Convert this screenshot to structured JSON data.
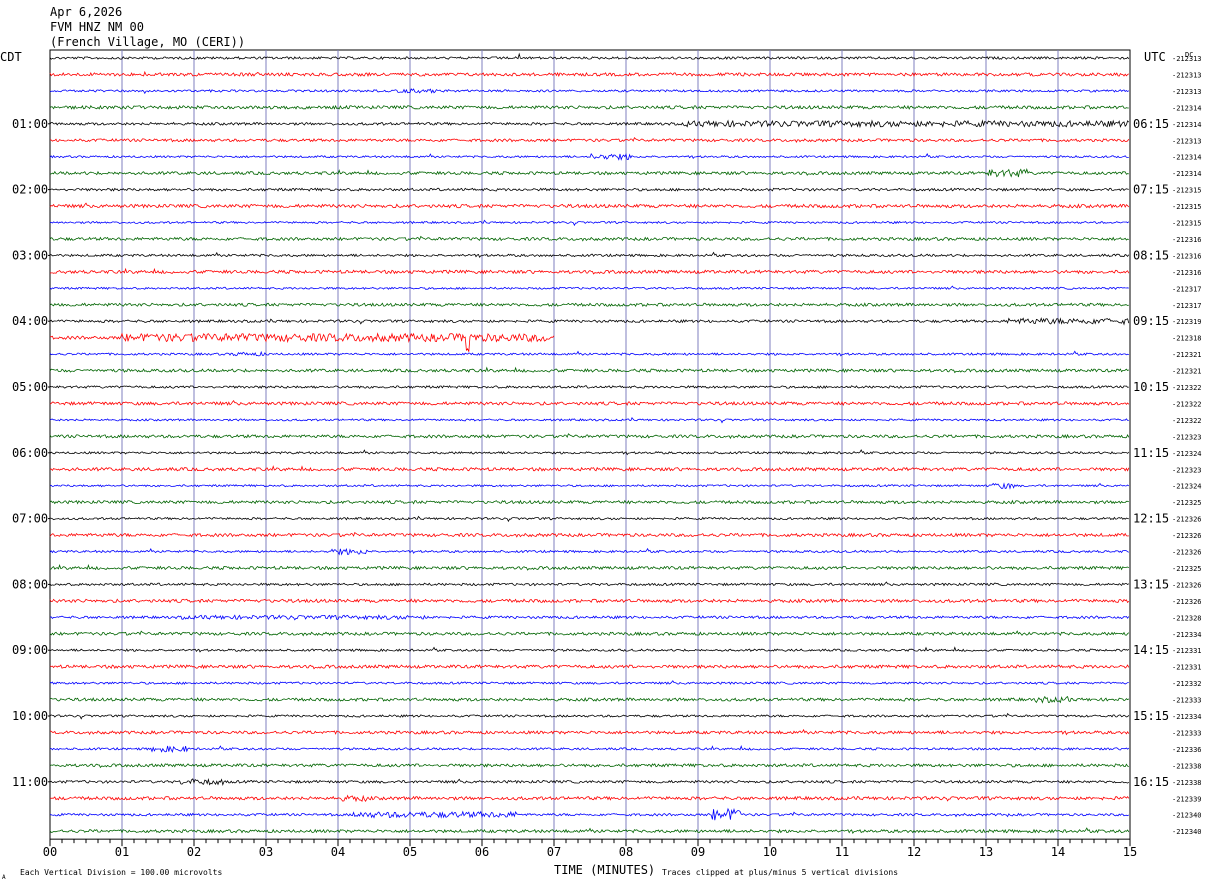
{
  "header": {
    "date": "Apr 6,2026",
    "station": "FVM HNZ NM 00",
    "location": "(French Village, MO (CERI))"
  },
  "labels": {
    "left_tz": "CDT",
    "right_tz": "UTC",
    "dc": "DC",
    "x_axis_title": "TIME (MINUTES)",
    "footer_left": "Each Vertical Division =  100.00 microvolts",
    "footer_right": "Traces clipped at plus/minus 5 vertical divisions",
    "corner_mark": "A"
  },
  "colors": {
    "traces": [
      "#000000",
      "#ff0000",
      "#0000ff",
      "#006400"
    ],
    "grid_vertical": "#7f7fbf"
  },
  "chart_data": {
    "type": "line",
    "title": "FVM HNZ NM 00",
    "xlabel": "TIME (MINUTES)",
    "x_ticks": [
      "00",
      "01",
      "02",
      "03",
      "04",
      "05",
      "06",
      "07",
      "08",
      "09",
      "10",
      "11",
      "12",
      "13",
      "14",
      "15"
    ],
    "xlim": [
      0,
      15
    ],
    "traces_per_hour": 4,
    "trace_minutes": 15,
    "left_hour_labels": [
      "01:00",
      "02:00",
      "03:00",
      "04:00",
      "05:00",
      "06:00",
      "07:00",
      "08:00",
      "09:00",
      "10:00",
      "11:00"
    ],
    "right_hour_labels": [
      "06:15",
      "07:15",
      "08:15",
      "09:15",
      "10:15",
      "11:15",
      "12:15",
      "13:15",
      "14:15",
      "15:15",
      "16:15"
    ],
    "dc_offsets": [
      "-212313",
      "-212313",
      "-212313",
      "-212314",
      "-212314",
      "-212313",
      "-212314",
      "-212314",
      "-212315",
      "-212315",
      "-212315",
      "-212316",
      "-212316",
      "-212316",
      "-212317",
      "-212317",
      "-212319",
      "-212318",
      "-212321",
      "-212321",
      "-212322",
      "-212322",
      "-212322",
      "-212323",
      "-212324",
      "-212323",
      "-212324",
      "-212325",
      "-212326",
      "-212326",
      "-212326",
      "-212325",
      "-212326",
      "-212326",
      "-212328",
      "-212334",
      "-212331",
      "-212331",
      "-212332",
      "-212333",
      "-212334",
      "-212333",
      "-212336",
      "-212338",
      "-212338",
      "-212339",
      "-212340",
      "-212340"
    ],
    "noise": [
      1.2,
      1.6,
      1.1,
      1.6,
      1.3,
      1.4,
      1.0,
      1.5,
      1.3,
      1.7,
      1.0,
      1.5,
      1.2,
      1.6,
      1.0,
      1.5,
      1.3,
      1.6,
      1.1,
      1.5,
      1.2,
      1.6,
      1.0,
      1.5,
      1.1,
      1.6,
      1.0,
      1.5,
      1.1,
      1.6,
      1.1,
      1.5,
      1.2,
      1.6,
      1.3,
      1.5,
      1.1,
      1.6,
      1.1,
      1.5,
      1.1,
      1.5,
      1.1,
      1.5,
      1.3,
      1.6,
      1.2,
      1.5
    ],
    "events": [
      {
        "trace": 2,
        "start": 4.8,
        "end": 5.4,
        "amplitude": 2
      },
      {
        "trace": 4,
        "start": 8.8,
        "end": 15.0,
        "amplitude": 3
      },
      {
        "trace": 6,
        "start": 7.5,
        "end": 8.1,
        "amplitude": 3
      },
      {
        "trace": 7,
        "start": 13.0,
        "end": 13.6,
        "amplitude": 4
      },
      {
        "trace": 16,
        "start": 13.3,
        "end": 15.0,
        "amplitude": 3
      },
      {
        "trace": 17,
        "start": 1.0,
        "end": 7.0,
        "amplitude": 4,
        "spike": 5.8,
        "spike_amp": 12
      },
      {
        "trace": 18,
        "start": 2.5,
        "end": 3.0,
        "amplitude": 2
      },
      {
        "trace": 26,
        "start": 13.1,
        "end": 13.4,
        "amplitude": 3
      },
      {
        "trace": 30,
        "start": 3.9,
        "end": 4.4,
        "amplitude": 3
      },
      {
        "trace": 34,
        "start": 1.8,
        "end": 5.2,
        "amplitude": 2
      },
      {
        "trace": 39,
        "start": 13.7,
        "end": 14.2,
        "amplitude": 3
      },
      {
        "trace": 42,
        "start": 1.4,
        "end": 1.9,
        "amplitude": 3
      },
      {
        "trace": 44,
        "start": 1.8,
        "end": 2.4,
        "amplitude": 3
      },
      {
        "trace": 45,
        "start": 4.0,
        "end": 4.4,
        "amplitude": 3
      },
      {
        "trace": 46,
        "start": 4.2,
        "end": 6.5,
        "amplitude": 3
      },
      {
        "trace": 46,
        "start": 9.2,
        "end": 9.6,
        "amplitude": 6
      }
    ],
    "truncated_after": {
      "trace": 17,
      "minute": 7.0
    }
  }
}
